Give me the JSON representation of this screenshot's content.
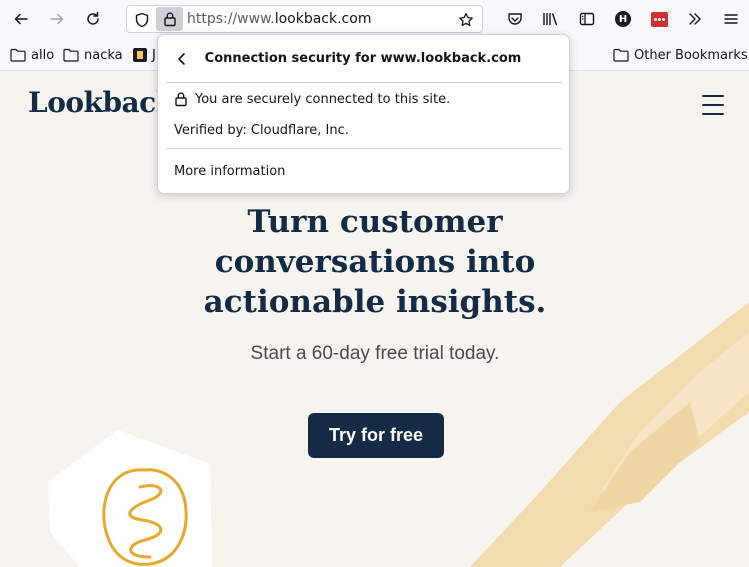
{
  "browser": {
    "url_prefix": "https://www.",
    "url_host": "lookback.com",
    "profile_initial": "H"
  },
  "bookmarks": {
    "items": [
      {
        "label": "allo"
      },
      {
        "label": "nacka"
      },
      {
        "label": "J"
      }
    ],
    "other_label": "Other Bookmarks"
  },
  "popup": {
    "title": "Connection security for www.lookback.com",
    "secure_text": "You are securely connected to this site.",
    "verified_text": "Verified by: Cloudflare, Inc.",
    "more_info_label": "More information"
  },
  "page": {
    "logo_text": "Lookback",
    "headline_lines": [
      "Turn customer",
      "conversations into",
      "actionable insights."
    ],
    "subhead": "Start a 60-day free trial today.",
    "cta_label": "Try for free"
  },
  "colors": {
    "brand_navy": "#132b45",
    "page_bg": "#f7f4f0",
    "accent_yellow": "#f2c94c"
  }
}
